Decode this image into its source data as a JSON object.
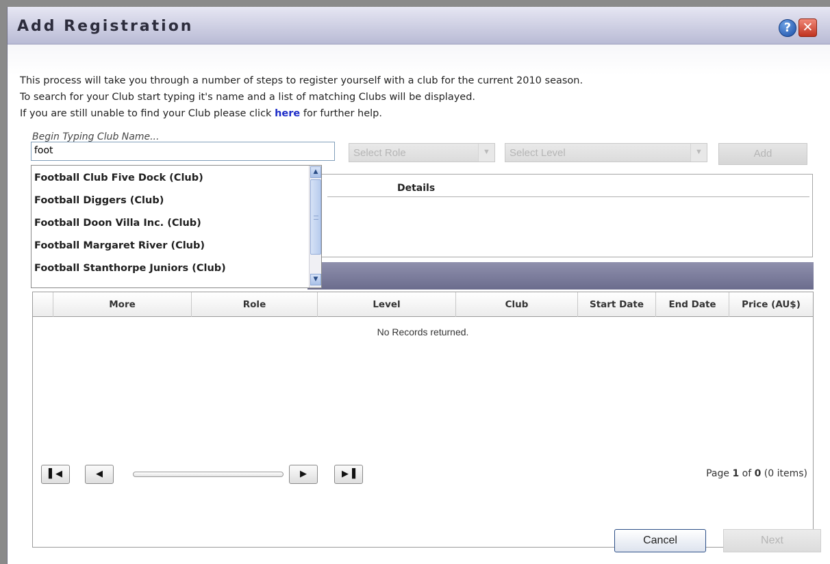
{
  "dialog": {
    "title": "Add Registration",
    "help_icon": "help-icon",
    "close_icon": "close-icon"
  },
  "intro": {
    "line1": "This process will take you through a number of steps to register yourself with a club for the current 2010 season.",
    "line2": "To search for your Club start typing it's name and a list of matching Clubs will be displayed.",
    "line3_pre": "If you are still unable to find your Club please click ",
    "line3_link": "here",
    "line3_post": " for further help."
  },
  "search": {
    "label": "Begin Typing Club Name...",
    "value": "foot"
  },
  "role_select": {
    "placeholder": "Select Role"
  },
  "level_select": {
    "placeholder": "Select Level"
  },
  "add_button": {
    "label": "Add"
  },
  "suggestions": [
    "Football Club Five Dock (Club)",
    "Football Diggers (Club)",
    "Football Doon Villa Inc. (Club)",
    "Football Margaret River (Club)",
    "Football Stanthorpe Juniors (Club)"
  ],
  "details": {
    "header": "Details"
  },
  "grid": {
    "columns": [
      "More",
      "Role",
      "Level",
      "Club",
      "Start Date",
      "End Date",
      "Price (AU$)"
    ],
    "empty_message": "No Records returned."
  },
  "pager": {
    "prefix": "Page ",
    "current": "1",
    "of": " of ",
    "total": "0",
    "items": " (0 items)"
  },
  "footer": {
    "cancel_label": "Cancel",
    "next_label": "Next"
  }
}
